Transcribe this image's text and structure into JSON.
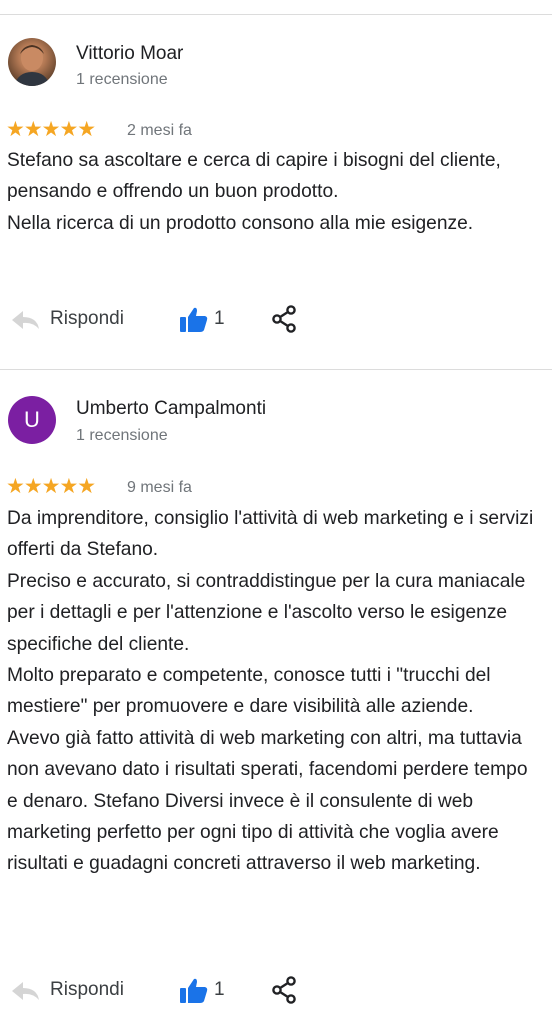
{
  "colors": {
    "star": "#f5a623",
    "like": "#1a73e8",
    "avatar_letter_bg": "#7b1fa2"
  },
  "reviews": [
    {
      "author": "Vittorio Moar",
      "review_count": "1 recensione",
      "avatar": {
        "type": "photo"
      },
      "rating": 5,
      "stars": "★★★★★",
      "time_ago": "2 mesi fa",
      "text": [
        "Stefano sa ascoltare e cerca di capire i bisogni del cliente, pensando e offrendo un buon prodotto.",
        "Nella ricerca di un prodotto consono alla mie esigenze."
      ],
      "reply_label": "Rispondi",
      "likes": "1"
    },
    {
      "author": "Umberto Campalmonti",
      "review_count": "1 recensione",
      "avatar": {
        "type": "letter",
        "letter": "U"
      },
      "rating": 5,
      "stars": "★★★★★",
      "time_ago": "9 mesi fa",
      "text": [
        "Da imprenditore, consiglio l'attività di web marketing e i servizi offerti da Stefano.",
        "Preciso e accurato, si contraddistingue per la cura maniacale per i dettagli e per l'attenzione e l'ascolto verso le esigenze specifiche del cliente.",
        "Molto preparato e competente, conosce tutti i \"trucchi del mestiere\" per promuovere e dare visibilità alle aziende.",
        "Avevo già fatto attività di web marketing con altri, ma tuttavia non avevano dato i risultati sperati, facendomi perdere tempo e denaro. Stefano Diversi invece è il consulente di web marketing perfetto per ogni tipo di attività che voglia avere risultati e guadagni concreti attraverso il web marketing."
      ],
      "reply_label": "Rispondi",
      "likes": "1"
    }
  ]
}
